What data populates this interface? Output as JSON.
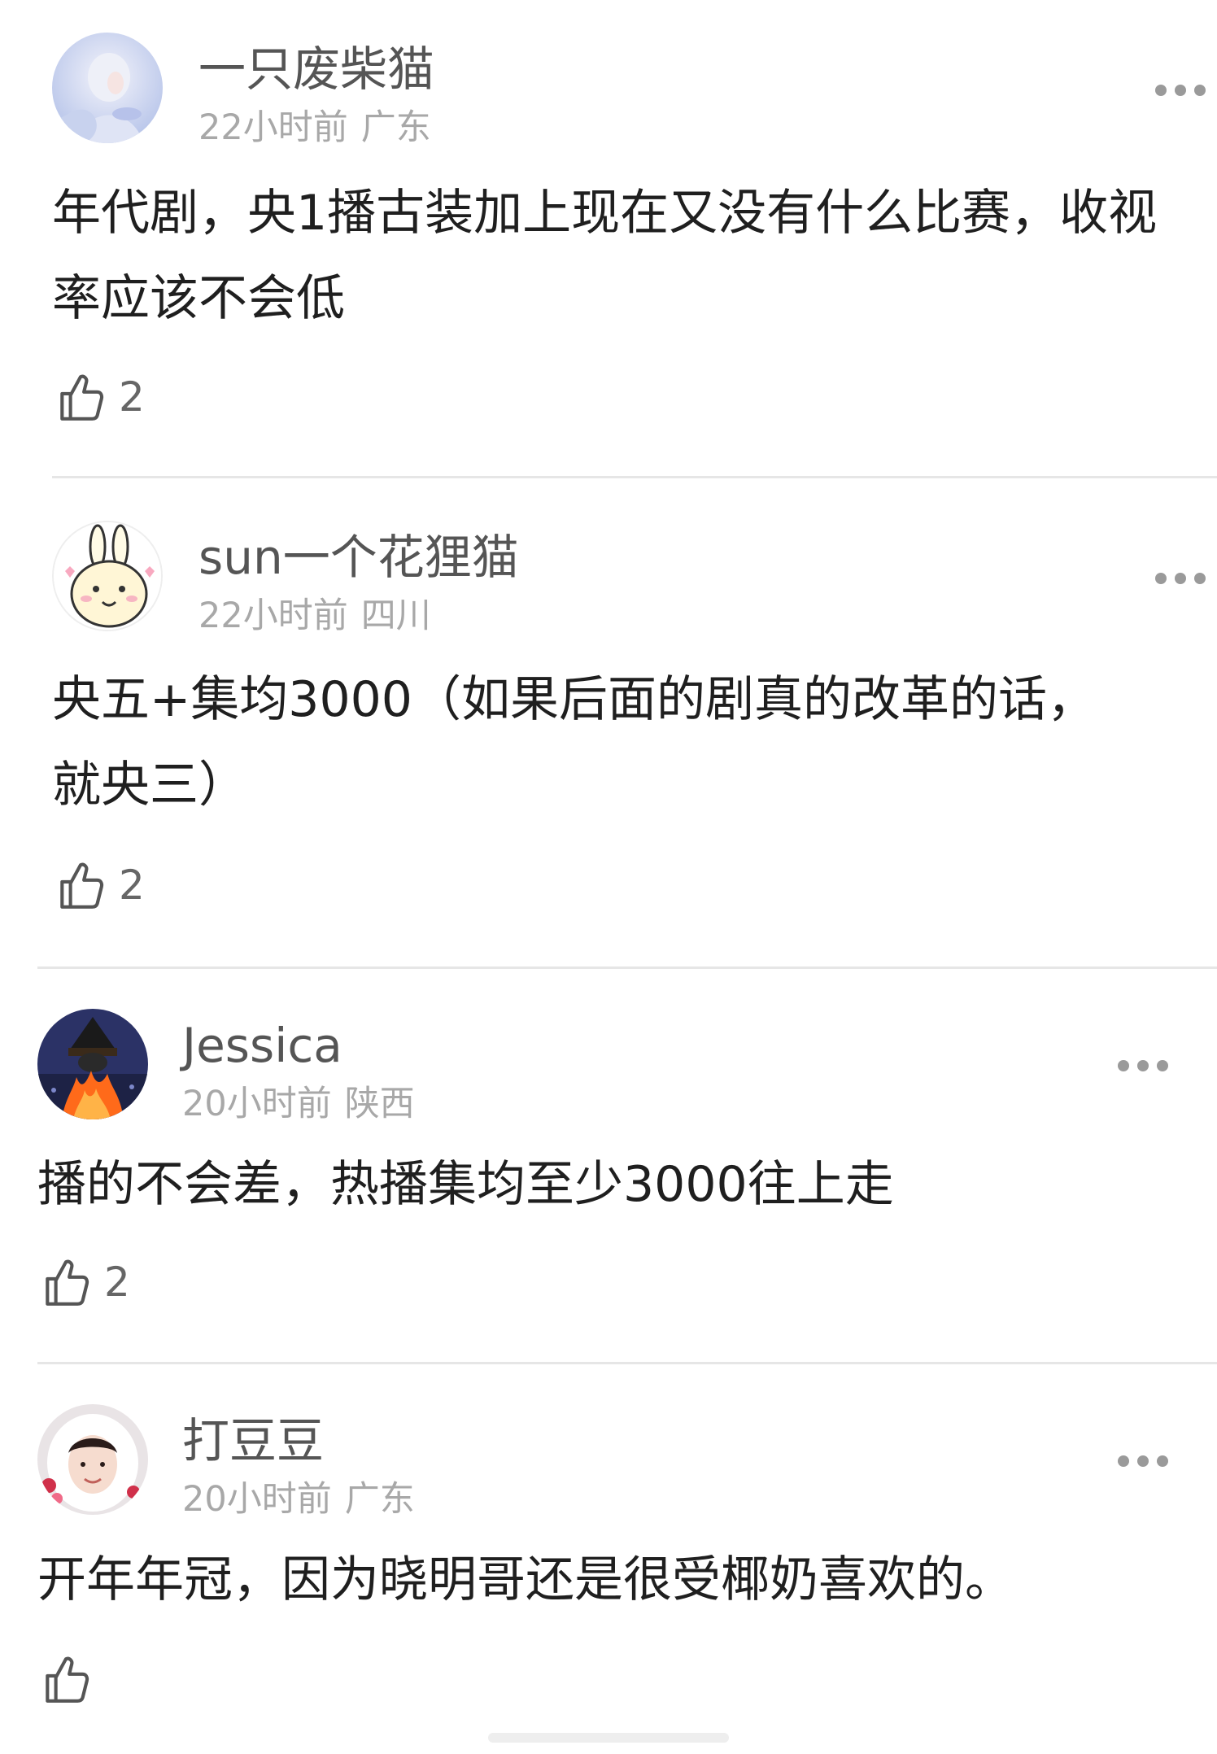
{
  "comments": [
    {
      "username": "一只废柴猫",
      "time": "22小时前",
      "location": "广东",
      "text": "年代剧，央1播古装加上现在又没有什么比赛，收视率应该不会低",
      "likes": "2",
      "avatar_icon": "avatar-white-haired-girl",
      "more_icon": "more-icon"
    },
    {
      "username": "sun一个花狸猫",
      "time": "22小时前",
      "location": "四川",
      "text": "央五+集均3000（如果后面的剧真的改革的话，就央三）",
      "likes": "2",
      "avatar_icon": "avatar-cartoon-bunny",
      "more_icon": "more-icon"
    },
    {
      "username": "Jessica",
      "time": "20小时前",
      "location": "陕西",
      "text": "播的不会差，热播集均至少3000往上走",
      "likes": "2",
      "avatar_icon": "avatar-witch-fire",
      "more_icon": "more-icon"
    },
    {
      "username": "打豆豆",
      "time": "20小时前",
      "location": "广东",
      "text": "开年年冠，因为晓明哥还是很受椰奶喜欢的。",
      "likes": "",
      "avatar_icon": "avatar-girl-white-hood",
      "more_icon": "more-icon"
    }
  ],
  "colors": {
    "username": "#555555",
    "meta": "#a8a8a8",
    "body_text": "#1f1f1f",
    "divider": "#e6e6e6"
  }
}
